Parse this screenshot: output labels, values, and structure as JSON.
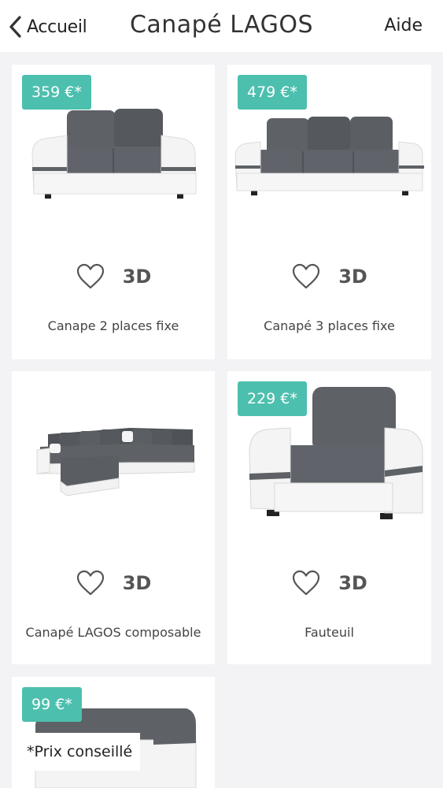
{
  "nav": {
    "back_label": "Accueil",
    "title": "Canapé LAGOS",
    "help_label": "Aide"
  },
  "products": [
    {
      "price": "359 €*",
      "name": "Canape 2 places fixe",
      "view_label": "3D"
    },
    {
      "price": "479 €*",
      "name": "Canapé 3 places fixe",
      "view_label": "3D"
    },
    {
      "price": "",
      "name": "Canapé LAGOS composable",
      "view_label": "3D"
    },
    {
      "price": "229 €*",
      "name": "Fauteuil",
      "view_label": "3D"
    },
    {
      "price": "99 €*",
      "name": "",
      "view_label": ""
    }
  ],
  "footnote": "*Prix conseillé",
  "colors": {
    "accent": "#4dbfae",
    "background": "#f3f2f5",
    "card": "#ffffff",
    "fabric_grey": "#5e6166",
    "leather_white": "#f2f2f2"
  },
  "icons": {
    "back": "chevron-left-icon",
    "favorite": "heart-outline-icon"
  }
}
